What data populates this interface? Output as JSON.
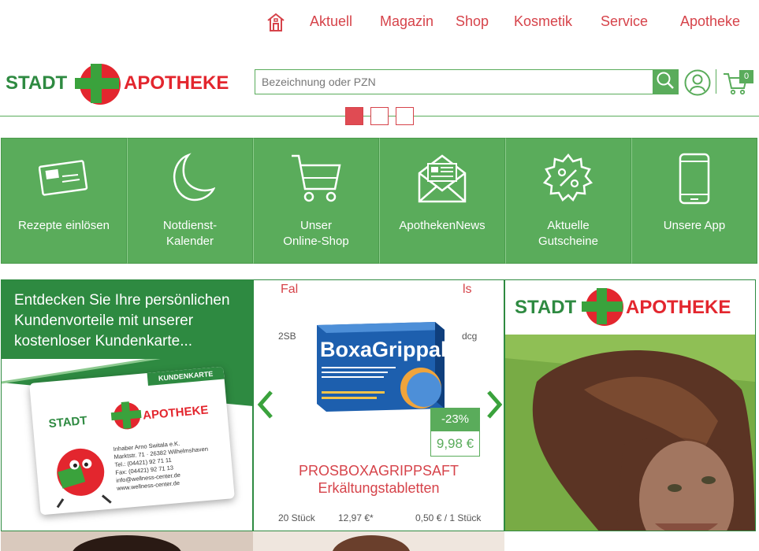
{
  "nav": {
    "home_icon": "home-icon",
    "items": [
      {
        "label": "Aktuell"
      },
      {
        "label": "Magazin"
      },
      {
        "label": "Shop"
      },
      {
        "label": "Kosmetik"
      },
      {
        "label": "Service"
      },
      {
        "label": "Apotheke"
      }
    ]
  },
  "logo": {
    "left": "STADT",
    "right": "APOTHEKE"
  },
  "search": {
    "placeholder": "Bezeichnung oder PZN",
    "icon": "search-icon"
  },
  "cart": {
    "count": "0",
    "icon": "cart-icon"
  },
  "user": {
    "icon": "user-icon"
  },
  "tiles": [
    {
      "line1": "Rezepte einlösen",
      "line2": "",
      "icon": "prescription-card-icon"
    },
    {
      "line1": "Notdienst-",
      "line2": "Kalender",
      "icon": "moon-icon"
    },
    {
      "line1": "Unser",
      "line2": "Online-Shop",
      "icon": "shopping-cart-icon"
    },
    {
      "line1": "ApothekenNews",
      "line2": "",
      "icon": "newsletter-icon"
    },
    {
      "line1": "Aktuelle",
      "line2": "Gutscheine",
      "icon": "coupon-icon"
    },
    {
      "line1": "Unsere App",
      "line2": "",
      "icon": "smartphone-icon"
    }
  ],
  "promo": {
    "text": "Entdecken Sie Ihre persönlichen Kundenvorteile mit unserer kostenloser Kundenkarte...",
    "card_label": "KUNDENKARTE",
    "card_owner": "Inhaber Arno Switala e.K.",
    "card_addr": "Marktstr. 71 · 26382 Wilhelmshaven",
    "card_tel": "Tel.: (04421) 92 71 11",
    "card_fax": "Fax: (04421) 92 71 13",
    "card_mail": "info@wellness-center.de",
    "card_web": "www.wellness-center.de"
  },
  "product": {
    "box_brand": "BoxaGrippal",
    "overlapped_top": [
      "Fal",
      "ls"
    ],
    "overlapped_left": "2SB",
    "overlapped_right": "dcg",
    "discount": "-23%",
    "price": "9,98 €",
    "title_garbled": "PROSBOXAGRIPPSAFT",
    "title_line2": "Erkältungstabletten",
    "footer_left": "20 Stück",
    "footer_mid": "12,97 €*",
    "footer_right": "0,50 € / 1 Stück"
  },
  "colors": {
    "brand_red": "#d6434a",
    "brand_green": "#5aac5b",
    "dark_green": "#2e8a41"
  }
}
